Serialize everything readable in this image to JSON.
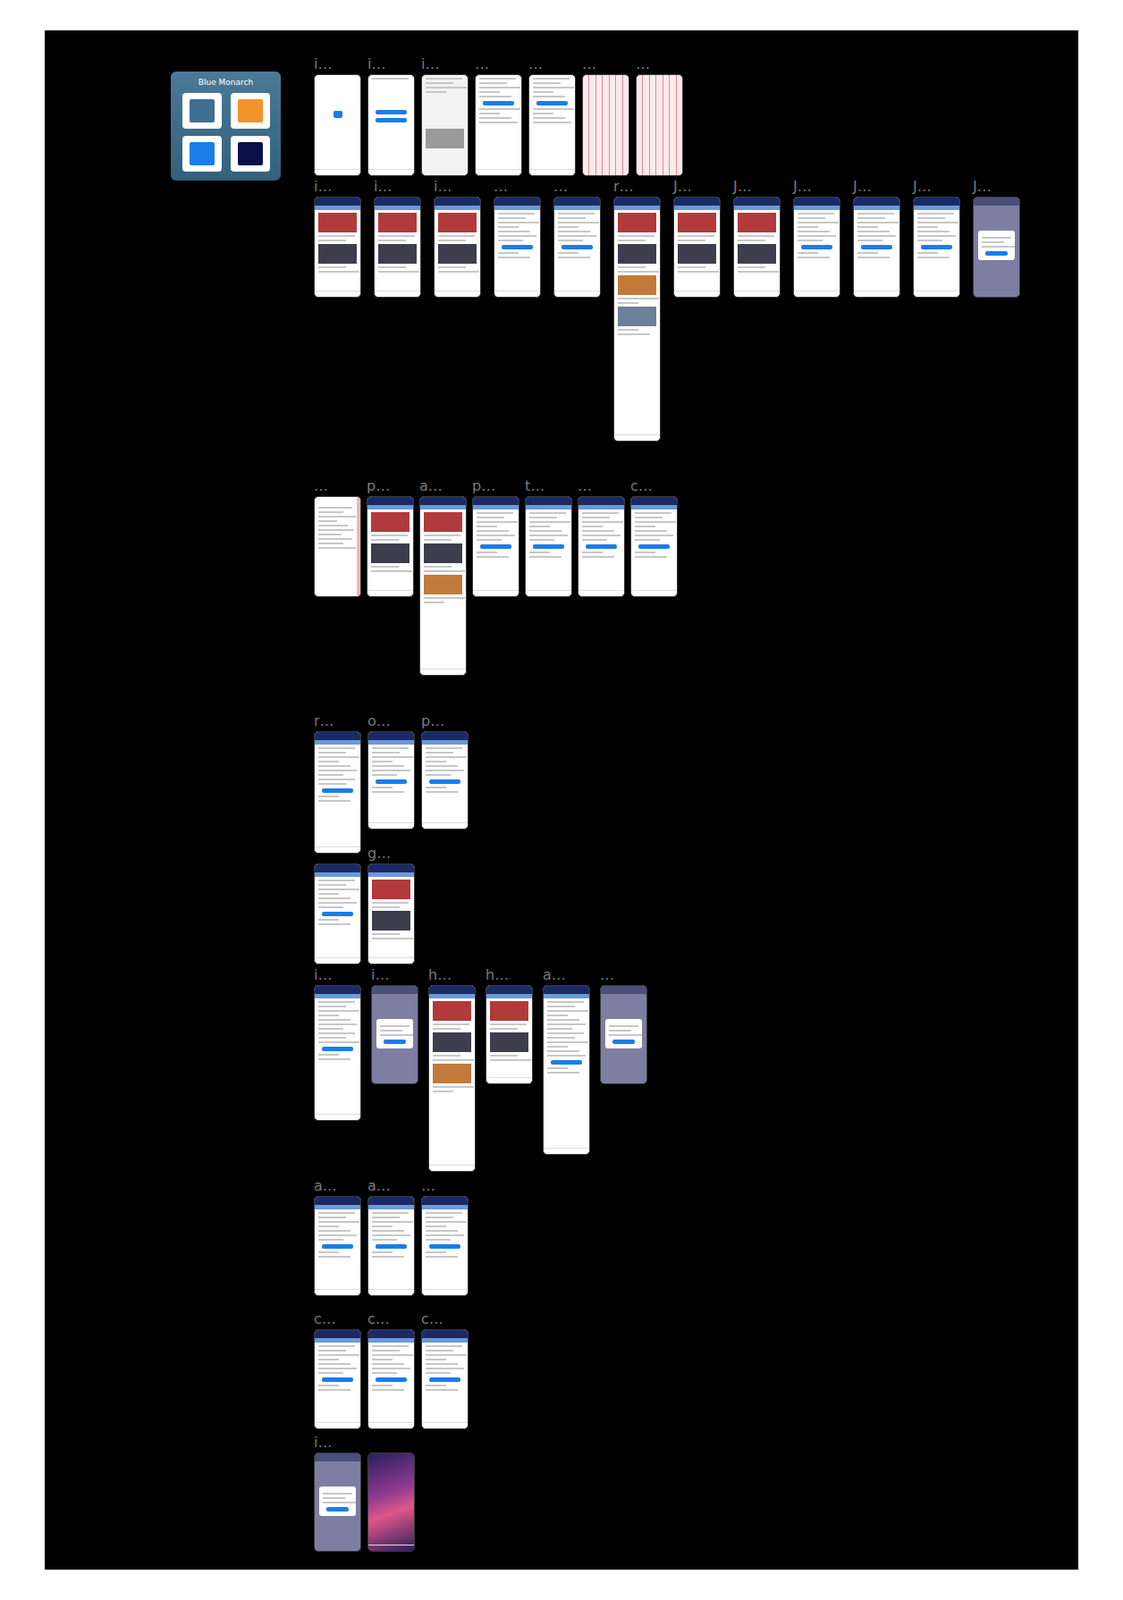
{
  "canvas": {
    "logo": {
      "title": "Blue Monarch",
      "swatches": [
        {
          "color": "#3e6f94"
        },
        {
          "color": "#f0932b"
        },
        {
          "color": "#1a7de8"
        },
        {
          "color": "#0a0f4a"
        }
      ]
    },
    "rows": [
      {
        "frames": [
          {
            "label": "i…",
            "kind": "splash"
          },
          {
            "label": "i…",
            "kind": "login"
          },
          {
            "label": "i…",
            "kind": "sheet"
          },
          {
            "label": "…",
            "kind": "form"
          },
          {
            "label": "…",
            "kind": "form"
          },
          {
            "label": "…",
            "kind": "grid"
          },
          {
            "label": "…",
            "kind": "grid"
          }
        ]
      },
      {
        "frames": [
          {
            "label": "i…",
            "kind": "media"
          },
          {
            "label": "i…",
            "kind": "media"
          },
          {
            "label": "i…",
            "kind": "media"
          },
          {
            "label": "…",
            "kind": "app"
          },
          {
            "label": "…",
            "kind": "app"
          },
          {
            "label": "r…",
            "kind": "media"
          },
          {
            "label": "J…",
            "kind": "media"
          },
          {
            "label": "J…",
            "kind": "media"
          },
          {
            "label": "J…",
            "kind": "app"
          },
          {
            "label": "J…",
            "kind": "app"
          },
          {
            "label": "J…",
            "kind": "app"
          },
          {
            "label": "J…",
            "kind": "overlay"
          }
        ]
      },
      {
        "frames": [
          {
            "label": "…",
            "kind": "menu"
          },
          {
            "label": "p…",
            "kind": "media"
          },
          {
            "label": "a…",
            "kind": "media"
          },
          {
            "label": "p…",
            "kind": "app"
          },
          {
            "label": "t…",
            "kind": "app"
          },
          {
            "label": "…",
            "kind": "app"
          },
          {
            "label": "c…",
            "kind": "app"
          }
        ]
      },
      {
        "frames": [
          {
            "label": "r…",
            "kind": "app"
          },
          {
            "label": "o…",
            "kind": "app"
          },
          {
            "label": "p…",
            "kind": "app"
          }
        ]
      },
      {
        "frames": [
          {
            "label": "",
            "kind": "app"
          },
          {
            "label": "g…",
            "kind": "media"
          }
        ]
      },
      {
        "frames": [
          {
            "label": "i…",
            "kind": "app"
          },
          {
            "label": "i…",
            "kind": "overlay"
          },
          {
            "label": "h…",
            "kind": "media"
          },
          {
            "label": "h…",
            "kind": "media"
          },
          {
            "label": "a…",
            "kind": "app"
          },
          {
            "label": "…",
            "kind": "overlay"
          }
        ]
      },
      {
        "frames": [
          {
            "label": "a…",
            "kind": "app"
          },
          {
            "label": "a…",
            "kind": "app"
          },
          {
            "label": "…",
            "kind": "app"
          }
        ]
      },
      {
        "frames": [
          {
            "label": "c…",
            "kind": "app"
          },
          {
            "label": "c…",
            "kind": "app"
          },
          {
            "label": "c…",
            "kind": "app"
          }
        ]
      },
      {
        "frames": [
          {
            "label": "i…",
            "kind": "overlay"
          },
          {
            "label": "",
            "kind": "wallpaper"
          }
        ]
      }
    ]
  }
}
